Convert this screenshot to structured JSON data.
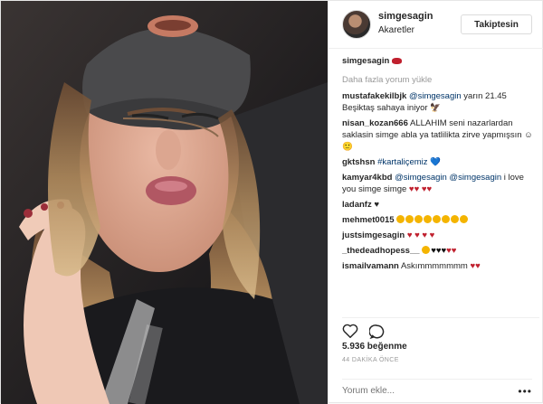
{
  "post": {
    "username": "simgesagin",
    "location": "Akaretler",
    "follow_label": "Takiptesin",
    "caption_user": "simgesagin",
    "load_more": "Daha fazla yorum yükle",
    "comments": [
      {
        "user": "mustafakekilbjk",
        "mention": "@simgesagin",
        "text": "yarın 21.45 Beşiktaş sahaya iniyor 🦅"
      },
      {
        "user": "nisan_kozan666",
        "mention": "",
        "text": "ALLAHIM seni nazarlardan saklasin simge abla ya tatlilikta zirve yapmışsın ☺🙂"
      },
      {
        "user": "gktshsn",
        "mention": "#kartaliçemiz",
        "text": "💙"
      },
      {
        "user": "kamyar4kbd",
        "mention": "@simgesagin @simgesagin",
        "text": "i love you simge simge"
      },
      {
        "user": "ladanfz",
        "mention": "",
        "text": "♥"
      },
      {
        "user": "mehmet0015",
        "mention": "",
        "text": ""
      },
      {
        "user": "justsimgesagin",
        "mention": "",
        "text": ""
      },
      {
        "user": "_thedeadhopess__",
        "mention": "",
        "text": ""
      },
      {
        "user": "ismailvamann",
        "mention": "",
        "text": "Askımmmmmmm"
      }
    ],
    "likes": "5.936 beğenme",
    "time": "44 DAKİKA ÖNCE",
    "comment_placeholder": "Yorum ekle..."
  },
  "icons": {
    "like": "heart-icon",
    "comment": "comment-bubble-icon",
    "more": "more-options-icon"
  }
}
